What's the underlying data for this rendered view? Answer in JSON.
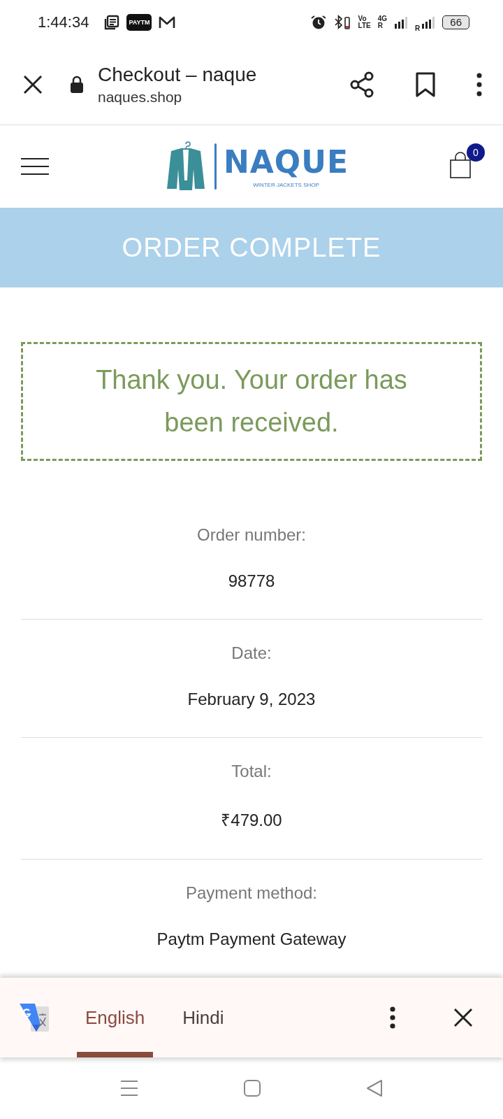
{
  "status_bar": {
    "time": "1:44:34",
    "paytm_badge": "PAYTM",
    "volte": "Vo",
    "lte": "LTE",
    "network": "4G",
    "roaming": [
      "R",
      "R"
    ],
    "battery": "66"
  },
  "browser_bar": {
    "title": "Checkout – naque",
    "url": "naques.shop"
  },
  "site_header": {
    "brand": "NAQUE",
    "tagline": "WINTER JACKETS SHOP",
    "cart_count": "0"
  },
  "banner": "ORDER COMPLETE",
  "notice": "Thank you. Your order has been received.",
  "details": [
    {
      "label": "Order number:",
      "value": "98778"
    },
    {
      "label": "Date:",
      "value": "February 9, 2023"
    },
    {
      "label": "Total:",
      "value": "₹479.00"
    },
    {
      "label": "Payment method:",
      "value": "Paytm Payment Gateway"
    }
  ],
  "translate_bar": {
    "tabs": [
      {
        "label": "English",
        "selected": true
      },
      {
        "label": "Hindi",
        "selected": false
      }
    ]
  }
}
